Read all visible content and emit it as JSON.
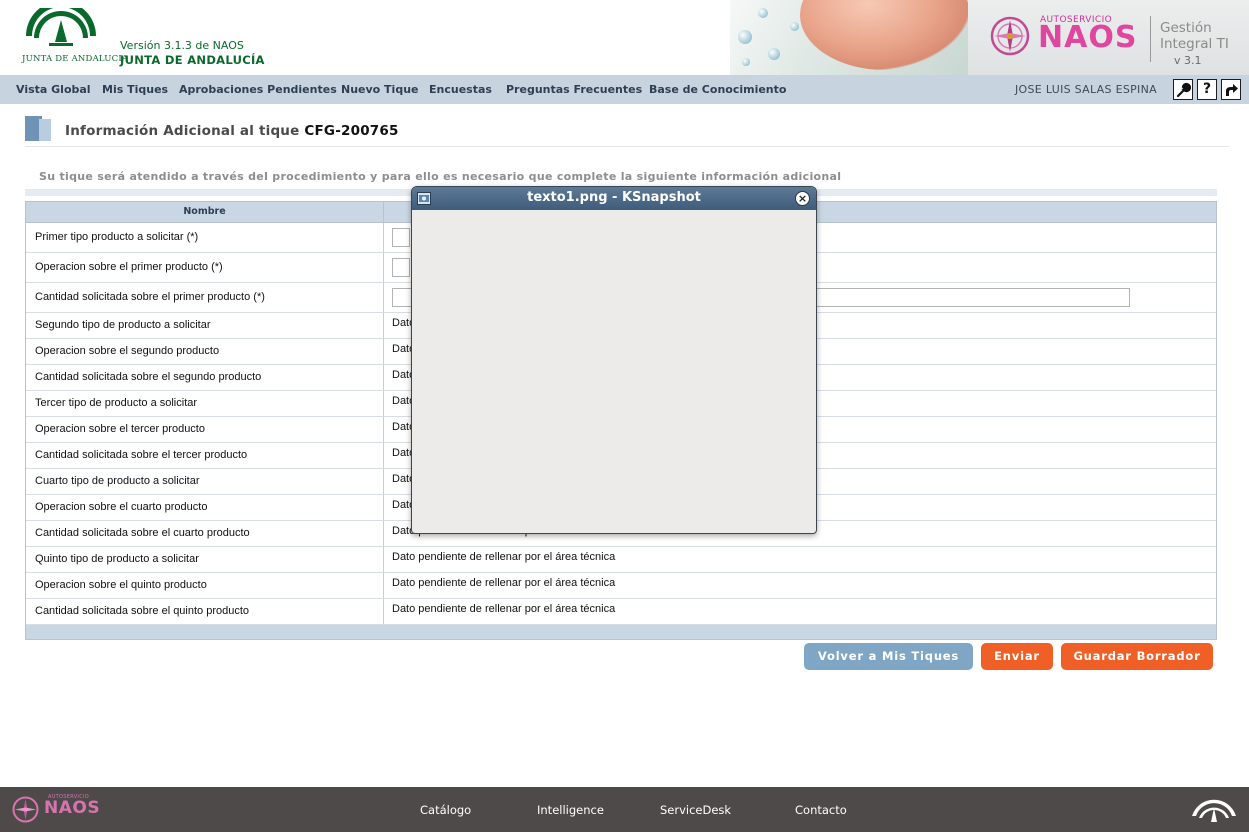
{
  "header": {
    "logo_caption": "JUNTA DE ANDALUCIA",
    "version": "Versión 3.1.3 de NAOS",
    "org": "JUNTA DE ANDALUCÍA",
    "brand": {
      "small": "AUTOSERVICIO",
      "word": "NAOS",
      "gestion_line1": "Gestión",
      "gestion_line2": "Integral TI",
      "version": "v 3.1"
    }
  },
  "nav": {
    "items": [
      {
        "label": "Vista Global"
      },
      {
        "label": "Mis Tiques"
      },
      {
        "label": "Aprobaciones Pendientes"
      },
      {
        "label": "Nuevo Tique"
      },
      {
        "label": "Encuestas"
      },
      {
        "label": "Preguntas Frecuentes"
      },
      {
        "label": "Base de Conocimiento"
      }
    ],
    "user": "JOSE LUIS SALAS ESPINA",
    "icons": [
      "wrench-icon",
      "help-icon",
      "logout-icon"
    ],
    "help_glyph": "?"
  },
  "page": {
    "title_prefix": "Información Adicional al tique",
    "ticket_id": "CFG-200765",
    "instructions": "Su tique será atendido a través del procedimiento y para ello es necesario que complete la siguiente información adicional"
  },
  "table": {
    "column_name": "Nombre",
    "rows": [
      {
        "name": "Primer tipo producto a solicitar (*)",
        "value": "",
        "input": true
      },
      {
        "name": "Operacion sobre el primer producto (*)",
        "value": "",
        "input": true
      },
      {
        "name": "Cantidad solicitada sobre el primer producto (*)",
        "value": "",
        "input": true
      },
      {
        "name": "Segundo tipo de producto a solicitar",
        "value": "Dato"
      },
      {
        "name": "Operacion sobre el segundo producto",
        "value": "Dato"
      },
      {
        "name": "Cantidad solicitada sobre el segundo producto",
        "value": "Dato"
      },
      {
        "name": "Tercer tipo de producto a solicitar",
        "value": "Dato"
      },
      {
        "name": "Operacion sobre el tercer producto",
        "value": "Dato"
      },
      {
        "name": "Cantidad solicitada sobre el tercer producto",
        "value": "Dato"
      },
      {
        "name": "Cuarto tipo de producto a solicitar",
        "value": "Dato"
      },
      {
        "name": "Operacion sobre el cuarto producto",
        "value": "Dato"
      },
      {
        "name": "Cantidad solicitada sobre el cuarto producto",
        "value": "Dato pendiente de rellenar por el área técnica"
      },
      {
        "name": "Quinto tipo de producto a solicitar",
        "value": "Dato pendiente de rellenar por el área técnica"
      },
      {
        "name": "Operacion sobre el quinto producto",
        "value": "Dato pendiente de rellenar por el área técnica"
      },
      {
        "name": "Cantidad solicitada sobre el quinto producto",
        "value": "Dato pendiente de rellenar por el área técnica"
      }
    ]
  },
  "buttons": {
    "back": "Volver a Mis Tiques",
    "send": "Enviar",
    "draft": "Guardar Borrador"
  },
  "popup": {
    "title": "texto1.png - KSnapshot",
    "close_glyph": "×"
  },
  "footer": {
    "logo_small": "AUTOSERVICIO",
    "logo_word": "NAOS",
    "links": [
      {
        "label": "Catálogo"
      },
      {
        "label": "Intelligence"
      },
      {
        "label": "ServiceDesk"
      },
      {
        "label": "Contacto"
      }
    ]
  },
  "colors": {
    "accent_orange": "#f05f26",
    "accent_blue": "#7fa6c4",
    "nav_bg": "#c8d3e0",
    "footer_bg": "#4d4a49",
    "junta_green": "#0a6a2c",
    "naos_pink": "#e0459f"
  }
}
